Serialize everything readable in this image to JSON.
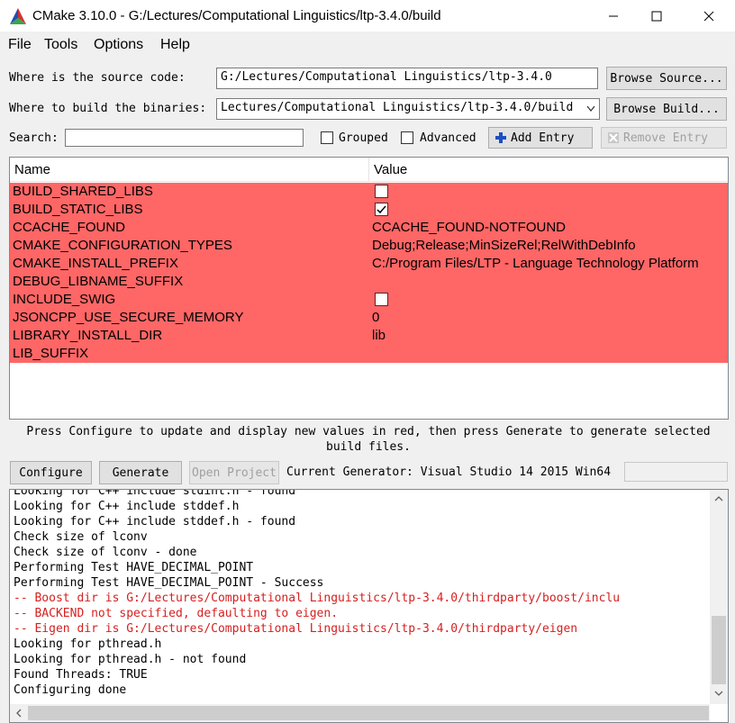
{
  "window": {
    "title": "CMake 3.10.0 - G:/Lectures/Computational Linguistics/ltp-3.4.0/build"
  },
  "menu": [
    "File",
    "Tools",
    "Options",
    "Help"
  ],
  "source": {
    "label": "Where is the source code:",
    "value": "G:/Lectures/Computational Linguistics/ltp-3.4.0",
    "browse": "Browse Source..."
  },
  "binaries": {
    "label": "Where to build the binaries:",
    "value": "Lectures/Computational Linguistics/ltp-3.4.0/build",
    "browse": "Browse Build..."
  },
  "search": {
    "label": "Search:",
    "value": "",
    "grouped": "Grouped",
    "advanced": "Advanced",
    "add_entry": "Add Entry",
    "remove_entry": "Remove Entry"
  },
  "table": {
    "headers": {
      "name": "Name",
      "value": "Value"
    },
    "rows": [
      {
        "name": "BUILD_SHARED_LIBS",
        "type": "bool",
        "checked": false
      },
      {
        "name": "BUILD_STATIC_LIBS",
        "type": "bool",
        "checked": true
      },
      {
        "name": "CCACHE_FOUND",
        "type": "text",
        "value": "CCACHE_FOUND-NOTFOUND"
      },
      {
        "name": "CMAKE_CONFIGURATION_TYPES",
        "type": "text",
        "value": "Debug;Release;MinSizeRel;RelWithDebInfo"
      },
      {
        "name": "CMAKE_INSTALL_PREFIX",
        "type": "text",
        "value": "C:/Program Files/LTP - Language Technology Platform"
      },
      {
        "name": "DEBUG_LIBNAME_SUFFIX",
        "type": "text",
        "value": ""
      },
      {
        "name": "INCLUDE_SWIG",
        "type": "bool",
        "checked": false
      },
      {
        "name": "JSONCPP_USE_SECURE_MEMORY",
        "type": "text",
        "value": "0"
      },
      {
        "name": "LIBRARY_INSTALL_DIR",
        "type": "text",
        "value": "lib"
      },
      {
        "name": "LIB_SUFFIX",
        "type": "text",
        "value": ""
      }
    ],
    "new_row_color": "#ff6666"
  },
  "hint": "Press Configure to update and display new values in red, then press Generate to generate selected build files.",
  "actions": {
    "configure": "Configure",
    "generate": "Generate",
    "open_project": "Open Project",
    "generator_label": "Current Generator: Visual Studio 14 2015 Win64"
  },
  "log": [
    {
      "text": "Looking for C++ include stdint.h - found",
      "red": false
    },
    {
      "text": "Looking for C++ include stddef.h",
      "red": false
    },
    {
      "text": "Looking for C++ include stddef.h - found",
      "red": false
    },
    {
      "text": "Check size of lconv",
      "red": false
    },
    {
      "text": "Check size of lconv - done",
      "red": false
    },
    {
      "text": "Performing Test HAVE_DECIMAL_POINT",
      "red": false
    },
    {
      "text": "Performing Test HAVE_DECIMAL_POINT - Success",
      "red": false
    },
    {
      "text": "-- Boost dir is G:/Lectures/Computational Linguistics/ltp-3.4.0/thirdparty/boost/inclu",
      "red": true
    },
    {
      "text": "-- BACKEND not specified, defaulting to eigen.",
      "red": true
    },
    {
      "text": "-- Eigen dir is G:/Lectures/Computational Linguistics/ltp-3.4.0/thirdparty/eigen",
      "red": true
    },
    {
      "text": "Looking for pthread.h",
      "red": false
    },
    {
      "text": "Looking for pthread.h - not found",
      "red": false
    },
    {
      "text": "Found Threads: TRUE",
      "red": false
    },
    {
      "text": "Configuring done",
      "red": false
    }
  ],
  "colors": {
    "error_text": "#d62020",
    "accent": "#0078d7"
  }
}
